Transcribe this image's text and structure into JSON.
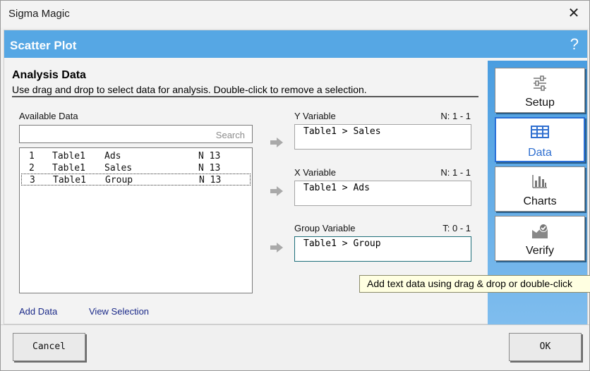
{
  "window": {
    "title": "Sigma Magic",
    "close": "✕"
  },
  "header": {
    "title": "Scatter Plot",
    "help": "?"
  },
  "section": {
    "title": "Analysis Data",
    "subtitle": "Use drag and drop to select data for analysis. Double-click to remove a selection."
  },
  "available": {
    "label": "Available Data",
    "search_placeholder": "Search",
    "rows": [
      {
        "num": "1",
        "table": "Table1",
        "name": "Ads",
        "count": "N 13",
        "selected": false
      },
      {
        "num": "2",
        "table": "Table1",
        "name": "Sales",
        "count": "N 13",
        "selected": false
      },
      {
        "num": "3",
        "table": "Table1",
        "name": "Group",
        "count": "N 13",
        "selected": true
      }
    ],
    "add_data": "Add Data",
    "view_selection": "View Selection"
  },
  "variables": [
    {
      "label": "Y Variable",
      "count": "N: 1 - 1",
      "value": "Table1 > Sales"
    },
    {
      "label": "X Variable",
      "count": "N: 1 - 1",
      "value": "Table1 > Ads"
    },
    {
      "label": "Group Variable",
      "count": "T: 0 - 1",
      "value": "Table1 > Group"
    }
  ],
  "sidebar": {
    "items": [
      {
        "label": "Setup",
        "icon": "sliders-icon"
      },
      {
        "label": "Data",
        "icon": "table-grid-icon"
      },
      {
        "label": "Charts",
        "icon": "bar-chart-icon"
      },
      {
        "label": "Verify",
        "icon": "verify-check-icon"
      }
    ]
  },
  "tooltip": "Add text data using drag & drop or double-click",
  "footer": {
    "cancel": "Cancel",
    "ok": "OK"
  },
  "colors": {
    "header": "#56a7e4",
    "sidebar": "#4a9de0",
    "active": "#2f6fd0"
  }
}
